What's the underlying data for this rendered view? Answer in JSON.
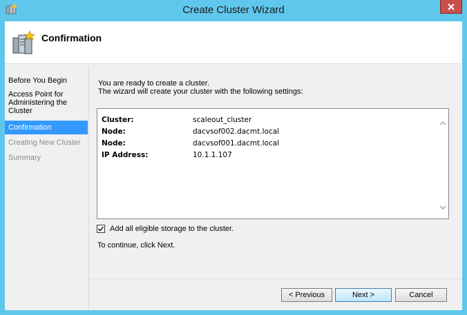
{
  "window": {
    "title": "Create Cluster Wizard"
  },
  "header": {
    "title": "Confirmation"
  },
  "nav": {
    "items": [
      {
        "label": "Before You Begin"
      },
      {
        "label": "Access Point for Administering the Cluster"
      },
      {
        "label": "Confirmation"
      },
      {
        "label": "Creating New Cluster"
      },
      {
        "label": "Summary"
      }
    ]
  },
  "content": {
    "intro_line1": "You are ready to create a cluster.",
    "intro_line2": "The wizard will create your cluster with the following settings:",
    "settings": [
      {
        "key": "Cluster:",
        "value": "scaleout_cluster"
      },
      {
        "key": "Node:",
        "value": "dacvsof002.dacmt.local"
      },
      {
        "key": "Node:",
        "value": "dacvsof001.dacmt.local"
      },
      {
        "key": "IP Address:",
        "value": "10.1.1.107"
      }
    ],
    "checkbox_label": "Add all eligible storage to the cluster.",
    "checkbox_checked": true,
    "continue_text": "To continue, click Next."
  },
  "buttons": {
    "previous": "< Previous",
    "next": "Next >",
    "cancel": "Cancel"
  },
  "colors": {
    "titlebar": "#60c7ec",
    "close": "#c7504b",
    "nav_active": "#3399ff"
  }
}
